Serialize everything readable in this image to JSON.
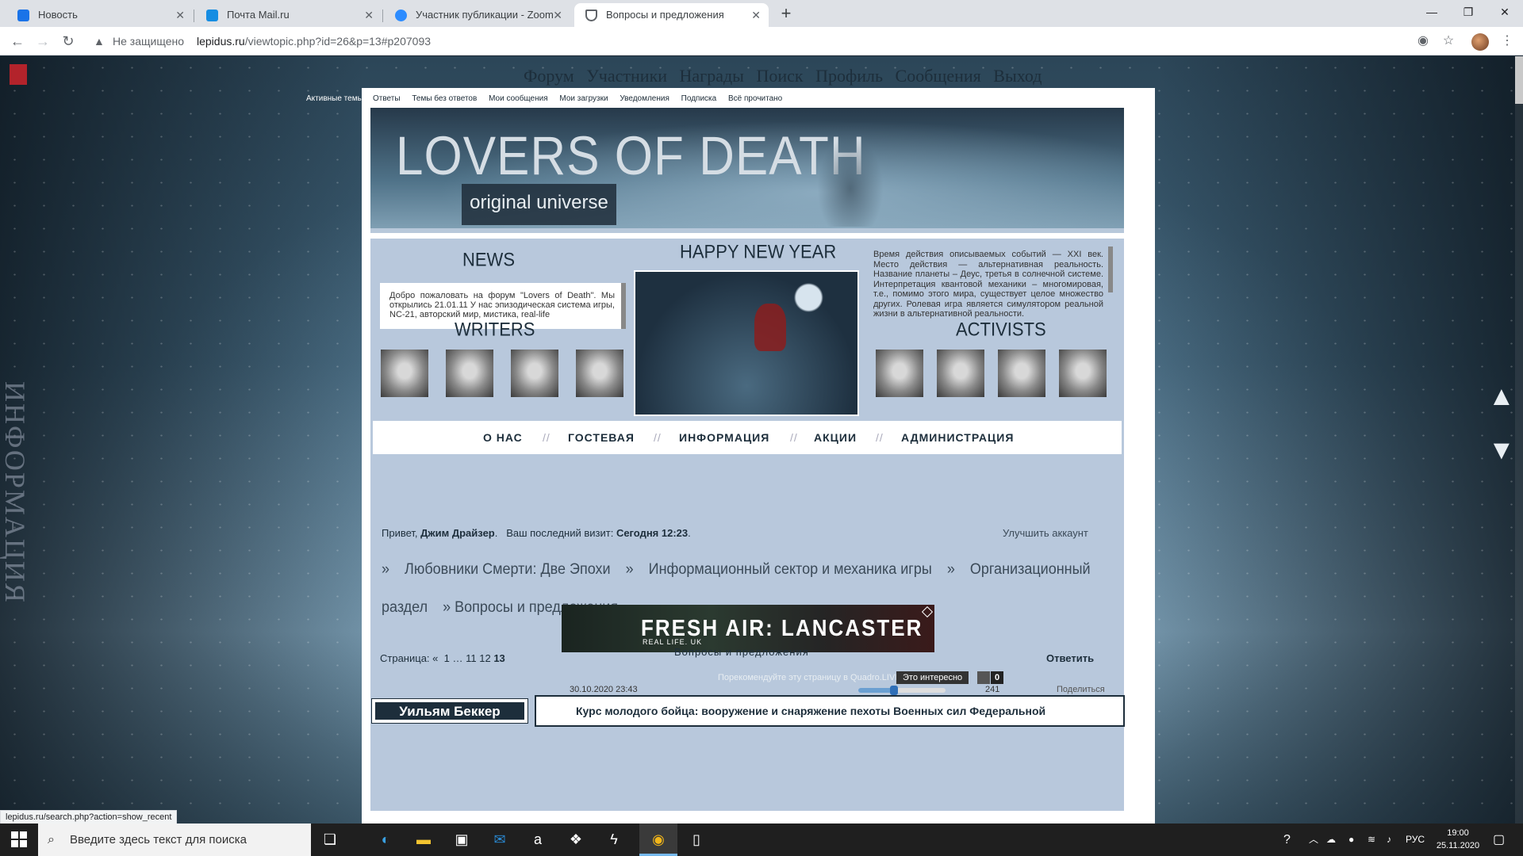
{
  "tabs": [
    {
      "title": "Новость",
      "color": "#1a73e8"
    },
    {
      "title": "Почта Mail.ru",
      "color": "#168de2"
    },
    {
      "title": "Участник публикации - Zoom",
      "color": "#2d8cff"
    },
    {
      "title": "Вопросы и предложения",
      "color": "#5f6368"
    }
  ],
  "address": {
    "security": "Не защищено",
    "host": "lepidus.ru",
    "path": "/viewtopic.php?id=26&p=13#p207093"
  },
  "site": {
    "menu": [
      "Форум",
      "Участники",
      "Награды",
      "Поиск",
      "Профиль",
      "Сообщения",
      "Выход"
    ],
    "side_text": "ИНФОРМАЦИЯ",
    "active_topics": "Активные темы",
    "sublinks": [
      "Ответы",
      "Темы без ответов",
      "Мои сообщения",
      "Мои загрузки",
      "Уведомления",
      "Подписка",
      "Всё прочитано"
    ],
    "banner_title": "LOVERS OF DEATH",
    "banner_subtitle": "original universe"
  },
  "panel": {
    "news_heading": "NEWS",
    "news_text": "Добро пожаловать на форум \"Lovers of Death\". Мы открылись 21.01.11 У нас эпизодическая система игры, NC-21, авторский мир, мистика, real-life",
    "ny_heading": "HAPPY NEW YEAR",
    "info_text": "Время действия описываемых событий — XXI век. Место действия — альтернативная реальность. Название планеты – Деус, третья в солнечной системе. Интерпретация квантовой механики – многомировая, т.е., помимо этого мира, существует целое множество других. Ролевая игра является симулятором реальной жизни в альтернативной реальности.",
    "writers_heading": "WRITERS",
    "activists_heading": "ACTIVISTS",
    "nav": [
      "О НАС",
      "ГОСТЕВАЯ",
      "ИНФОРМАЦИЯ",
      "АКЦИИ",
      "АДМИНИСТРАЦИЯ"
    ],
    "nav_sep": "//"
  },
  "greeting": {
    "hello": "Привет,",
    "user": "Джим Драйзер",
    "last_visit_label": "Ваш последний визит:",
    "last_visit": "Сегодня 12:23",
    "upgrade": "Улучшить аккаунт"
  },
  "breadcrumbs": [
    "»",
    "Любовники Смерти: Две Эпохи",
    "»",
    "Информационный сектор и механика игры",
    "»",
    "Организационный раздел",
    "» Вопросы и предложения"
  ],
  "ad": {
    "title": "FRESH AIR: LANCASTER",
    "subtitle": "REAL LIFE. UK"
  },
  "pagination": {
    "label": "Страница:",
    "items": [
      "«",
      "1",
      "…",
      "11",
      "12"
    ],
    "current": "13",
    "reply": "Ответить"
  },
  "topic_title": "Вопросы и предложения",
  "share": {
    "recommend": "Порекомендуйте эту страницу в Quadro.LIVE",
    "interesting": "Это интересно",
    "count": "0"
  },
  "post": {
    "date": "30.10.2020 23:43",
    "views": "241",
    "share_label": "Поделиться",
    "author": "Уильям Беккер",
    "heading": "Курс молодого бойца: вооружение и снаряжение пехоты Военных сил Федеральной"
  },
  "status_url": "lepidus.ru/search.php?action=show_recent",
  "taskbar": {
    "search_placeholder": "Введите здесь текст для поиска",
    "lang": "РУС",
    "time": "19:00",
    "date": "25.11.2020"
  }
}
